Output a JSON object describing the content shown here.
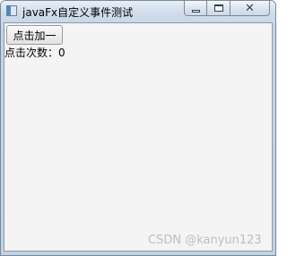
{
  "window": {
    "title": "javaFx自定义事件测试"
  },
  "caption_buttons": {
    "minimize_icon": "minimize-icon",
    "maximize_icon": "restore-icon",
    "close_glyph": "✕"
  },
  "content": {
    "button_label": "点击加一",
    "count_label": "点击次数：",
    "count_value": "0"
  },
  "watermark": {
    "text": "CSDN @kanyun123"
  }
}
